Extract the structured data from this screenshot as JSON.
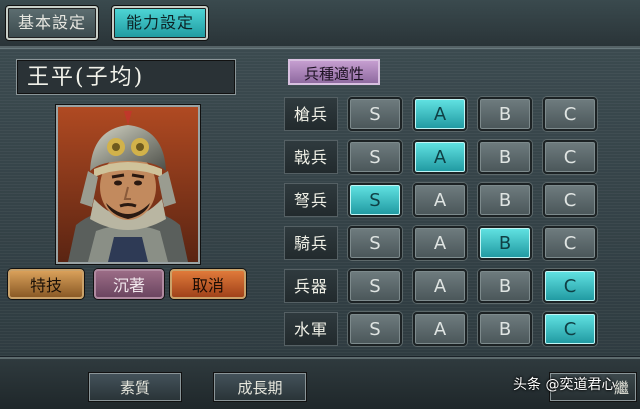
{
  "tabs": {
    "basic_label": "基本設定",
    "ability_label": "能力設定"
  },
  "officer": {
    "name": "王平(子均)"
  },
  "buttons": {
    "skill_label": "特技",
    "skill_value": "沉著",
    "cancel_label": "取消"
  },
  "aptitude": {
    "title": "兵種適性",
    "grade_options": [
      "S",
      "A",
      "B",
      "C"
    ],
    "rows": [
      {
        "label": "槍兵",
        "selected": "A"
      },
      {
        "label": "戟兵",
        "selected": "A"
      },
      {
        "label": "弩兵",
        "selected": "S"
      },
      {
        "label": "騎兵",
        "selected": "B"
      },
      {
        "label": "兵器",
        "selected": "C"
      },
      {
        "label": "水軍",
        "selected": "C"
      }
    ]
  },
  "bottom": {
    "quality_label": "素質",
    "growth_label": "成長期",
    "right_partial": "繼"
  },
  "watermark": "头条 @奕道君心",
  "colors": {
    "selected_cyan": "#3fc9cc",
    "tab_active": "#2fb6bb",
    "skill_orange": "#c17a36",
    "aptitude_purple": "#a57ab8"
  }
}
